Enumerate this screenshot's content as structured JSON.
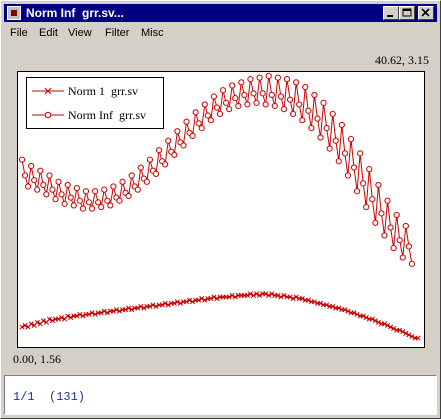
{
  "window": {
    "title": "Norm Inf  grr.sv...",
    "buttons": [
      "minimize-icon",
      "maximize-icon",
      "close-icon"
    ]
  },
  "menu": [
    "File",
    "Edit",
    "View",
    "Filter",
    "Misc"
  ],
  "plot": {
    "cursor_readout": "40.62, 3.15",
    "origin_readout": "0.00, 1.56",
    "line_color": "#cc0000",
    "legend": [
      {
        "label": "Norm 1  grr.sv",
        "marker": "x"
      },
      {
        "label": "Norm Inf  grr.sv",
        "marker": "circle"
      }
    ]
  },
  "chart_data": {
    "type": "line",
    "legend_position": "top-left",
    "grid": false,
    "xlim": [
      0,
      130
    ],
    "ylim": [
      1.56,
      3.15
    ],
    "series": [
      {
        "name": "Norm 1  grr.sv",
        "marker": "x",
        "values": [
          1.56,
          1.57,
          1.56,
          1.58,
          1.57,
          1.59,
          1.58,
          1.6,
          1.59,
          1.61,
          1.6,
          1.61,
          1.61,
          1.62,
          1.61,
          1.63,
          1.62,
          1.63,
          1.63,
          1.64,
          1.63,
          1.64,
          1.64,
          1.65,
          1.64,
          1.65,
          1.65,
          1.66,
          1.65,
          1.66,
          1.66,
          1.67,
          1.66,
          1.67,
          1.67,
          1.68,
          1.67,
          1.68,
          1.68,
          1.69,
          1.68,
          1.69,
          1.69,
          1.7,
          1.69,
          1.7,
          1.7,
          1.71,
          1.7,
          1.71,
          1.71,
          1.72,
          1.71,
          1.72,
          1.72,
          1.73,
          1.72,
          1.73,
          1.73,
          1.74,
          1.73,
          1.74,
          1.74,
          1.75,
          1.74,
          1.75,
          1.75,
          1.75,
          1.75,
          1.76,
          1.75,
          1.76,
          1.76,
          1.76,
          1.76,
          1.77,
          1.76,
          1.77,
          1.76,
          1.77,
          1.77,
          1.76,
          1.77,
          1.76,
          1.76,
          1.75,
          1.76,
          1.75,
          1.75,
          1.74,
          1.75,
          1.74,
          1.74,
          1.73,
          1.73,
          1.72,
          1.72,
          1.71,
          1.71,
          1.7,
          1.7,
          1.69,
          1.69,
          1.68,
          1.68,
          1.67,
          1.67,
          1.66,
          1.65,
          1.65,
          1.64,
          1.63,
          1.63,
          1.62,
          1.61,
          1.61,
          1.6,
          1.59,
          1.58,
          1.58,
          1.57,
          1.56,
          1.55,
          1.54,
          1.54,
          1.53,
          1.52,
          1.51,
          1.5,
          1.49,
          1.49
        ]
      },
      {
        "name": "Norm Inf  grr.sv",
        "marker": "circle",
        "values": [
          2.62,
          2.52,
          2.45,
          2.58,
          2.49,
          2.43,
          2.55,
          2.46,
          2.4,
          2.52,
          2.43,
          2.37,
          2.48,
          2.4,
          2.34,
          2.46,
          2.38,
          2.33,
          2.44,
          2.36,
          2.31,
          2.42,
          2.35,
          2.31,
          2.42,
          2.35,
          2.32,
          2.43,
          2.36,
          2.33,
          2.45,
          2.38,
          2.36,
          2.48,
          2.41,
          2.39,
          2.52,
          2.45,
          2.43,
          2.57,
          2.5,
          2.48,
          2.62,
          2.55,
          2.53,
          2.68,
          2.61,
          2.59,
          2.74,
          2.67,
          2.65,
          2.8,
          2.73,
          2.71,
          2.86,
          2.79,
          2.77,
          2.92,
          2.85,
          2.82,
          2.97,
          2.9,
          2.87,
          3.02,
          2.95,
          2.91,
          3.06,
          2.98,
          2.94,
          3.09,
          3.01,
          2.96,
          3.11,
          3.03,
          2.97,
          3.13,
          3.04,
          2.98,
          3.14,
          3.04,
          2.97,
          3.15,
          3.03,
          2.96,
          3.14,
          3.02,
          2.94,
          3.13,
          3.0,
          2.91,
          3.11,
          2.97,
          2.87,
          3.08,
          2.93,
          2.82,
          3.03,
          2.88,
          2.76,
          2.98,
          2.82,
          2.69,
          2.91,
          2.74,
          2.61,
          2.84,
          2.66,
          2.52,
          2.75,
          2.57,
          2.42,
          2.66,
          2.47,
          2.32,
          2.56,
          2.37,
          2.22,
          2.46,
          2.28,
          2.14,
          2.36,
          2.19,
          2.06,
          2.27,
          2.11,
          2.0,
          2.2,
          2.07,
          1.96
        ]
      }
    ]
  },
  "status": "1/1  (131)"
}
